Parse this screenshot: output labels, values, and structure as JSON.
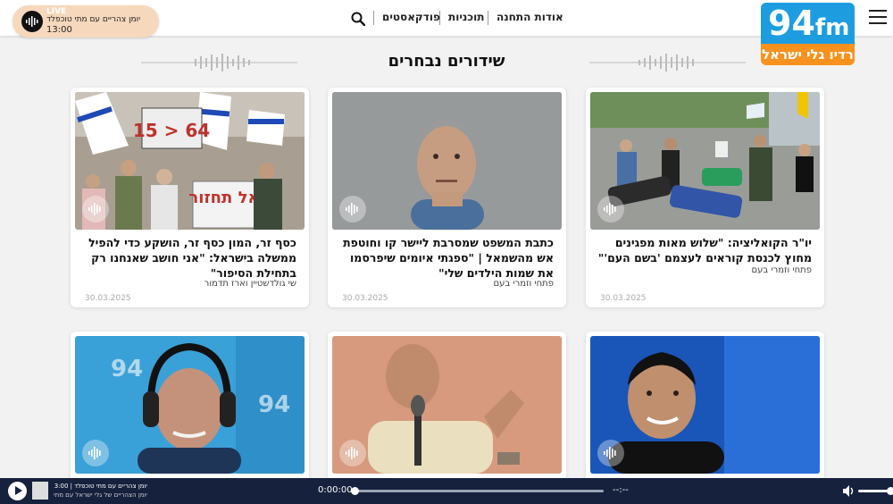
{
  "header": {
    "logo": {
      "number": "94",
      "suffix": "fm",
      "name": "רדיו גלי ישראל"
    },
    "nav": [
      "אודות התחנה",
      "תוכניות",
      "פודקאסטים"
    ],
    "live": {
      "badge": "LIVE",
      "show": "יומן צהריים עם מתי טוכפלד",
      "time": "13:00"
    }
  },
  "section_title": "שידורים נבחרים",
  "cards": [
    {
      "title": "יו\"ר הקואליציה: \"שלוש מאות מפגינים מחוץ לכנסת קוראים לעצמם 'בשם העם'\"",
      "author": "פתחי וזמרי בעם",
      "date": "30.03.2025"
    },
    {
      "title": "כתבת המשפט שמסרבת ליישר קו וחוטפת אש מהשמאל | \"ספגתי איומים שיפרסמו את שמות הילדים שלי\"",
      "author": "פתחי וזמרי בעם",
      "date": "30.03.2025"
    },
    {
      "title": "כסף זר, המון כסף זר, הושקע כדי להפיל ממשלה בישראל: \"אני חושב שאנחנו רק בתחילת הסיפור\"",
      "author": "שי גולדשטיין וארז תדמור",
      "date": "30.03.2025"
    },
    {
      "title": "",
      "author": "",
      "date": ""
    },
    {
      "title": "",
      "author": "",
      "date": ""
    },
    {
      "title": "",
      "author": "",
      "date": ""
    }
  ],
  "images": {
    "card1_sign": "אל תחזור",
    "card3_sign": "15 > 64"
  },
  "player": {
    "line1": "יומן צהריים עם מתי טוכפלד | 13:00",
    "line2": "יומן הצהריים של גלי ישראל עם מתי טוכפלד",
    "elapsed": "0:00:00",
    "remaining": "--:--",
    "progress": 0
  },
  "colors": {
    "logo_blue": "#1d9de0",
    "logo_orange": "#f7921e",
    "player_bg": "#15213d",
    "live_pill": "#f6d8bc"
  }
}
